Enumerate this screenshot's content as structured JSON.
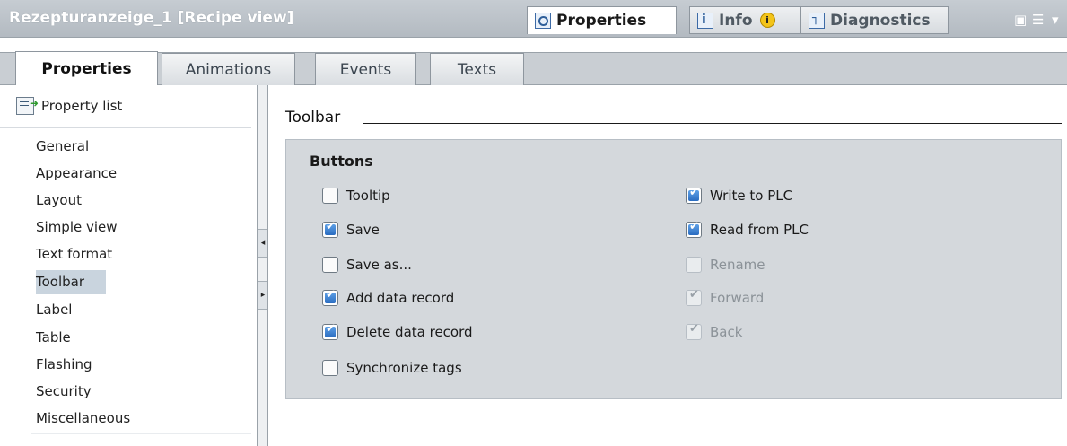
{
  "header": {
    "title": "Rezepturanzeige_1 [Recipe view]",
    "tabs": [
      {
        "label": "Properties",
        "icon": "magnifier-icon",
        "active": true
      },
      {
        "label": "Info",
        "icon": "info-icon",
        "active": false,
        "badge": "i"
      },
      {
        "label": "Diagnostics",
        "icon": "diagnostics-icon",
        "active": false
      }
    ],
    "window_controls": [
      "restore-icon",
      "layout-icon",
      "chevron-down-icon"
    ]
  },
  "subtabs": [
    {
      "label": "Properties",
      "active": true
    },
    {
      "label": "Animations",
      "active": false
    },
    {
      "label": "Events",
      "active": false
    },
    {
      "label": "Texts",
      "active": false
    }
  ],
  "nav": {
    "header": "Property list",
    "items": [
      {
        "label": "General"
      },
      {
        "label": "Appearance"
      },
      {
        "label": "Layout"
      },
      {
        "label": "Simple view"
      },
      {
        "label": "Text format"
      },
      {
        "label": "Toolbar",
        "selected": true
      },
      {
        "label": "Label"
      },
      {
        "label": "Table"
      },
      {
        "label": "Flashing"
      },
      {
        "label": "Security"
      },
      {
        "label": "Miscellaneous"
      }
    ]
  },
  "main": {
    "section_title": "Toolbar",
    "group_title": "Buttons",
    "left_column": [
      {
        "label": "Tooltip",
        "checked": false,
        "enabled": true
      },
      {
        "label": "Save",
        "checked": true,
        "enabled": true
      },
      {
        "label": "Save as...",
        "checked": false,
        "enabled": true
      },
      {
        "label": "Add data record",
        "checked": true,
        "enabled": true
      },
      {
        "label": "Delete data record",
        "checked": true,
        "enabled": true
      },
      {
        "label": "Synchronize tags",
        "checked": false,
        "enabled": true
      }
    ],
    "right_column": [
      {
        "label": "Write to PLC",
        "checked": true,
        "enabled": true
      },
      {
        "label": "Read from PLC",
        "checked": true,
        "enabled": true
      },
      {
        "label": "Rename",
        "checked": false,
        "enabled": false
      },
      {
        "label": "Forward",
        "checked": true,
        "enabled": false
      },
      {
        "label": "Back",
        "checked": true,
        "enabled": false
      }
    ]
  },
  "colors": {
    "header_bg": "#b9c0c7",
    "group_bg": "#d4d8dc",
    "selection": "#c9d4de",
    "checkbox_blue": "#2a6cc0"
  }
}
